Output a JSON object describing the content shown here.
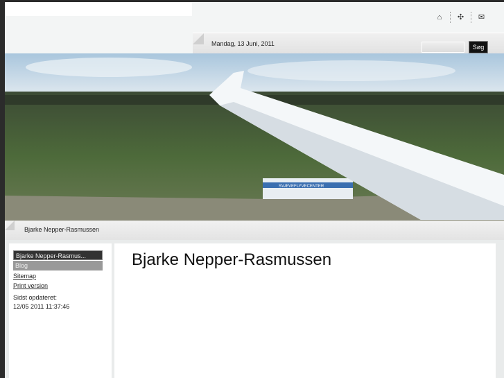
{
  "header": {
    "icons": [
      "home-icon",
      "sitemap-icon",
      "mail-icon"
    ],
    "date": "Mandag, 13 Juni, 2011",
    "search": {
      "value": "",
      "button": "Søg"
    }
  },
  "breadcrumb": "Bjarke Nepper-Rasmussen",
  "sidebar": {
    "items": [
      {
        "label": "Bjarke Nepper-Rasmus..."
      },
      {
        "label": "Blog"
      }
    ],
    "links": [
      "Sitemap",
      "Print version"
    ],
    "updated_label": "Sidst opdateret:",
    "updated_value": "12/05 2011 11:37:46"
  },
  "main": {
    "title": "Bjarke Nepper-Rasmussen"
  },
  "banner": {
    "sign": "SVÆVEFLYVECENTER"
  }
}
